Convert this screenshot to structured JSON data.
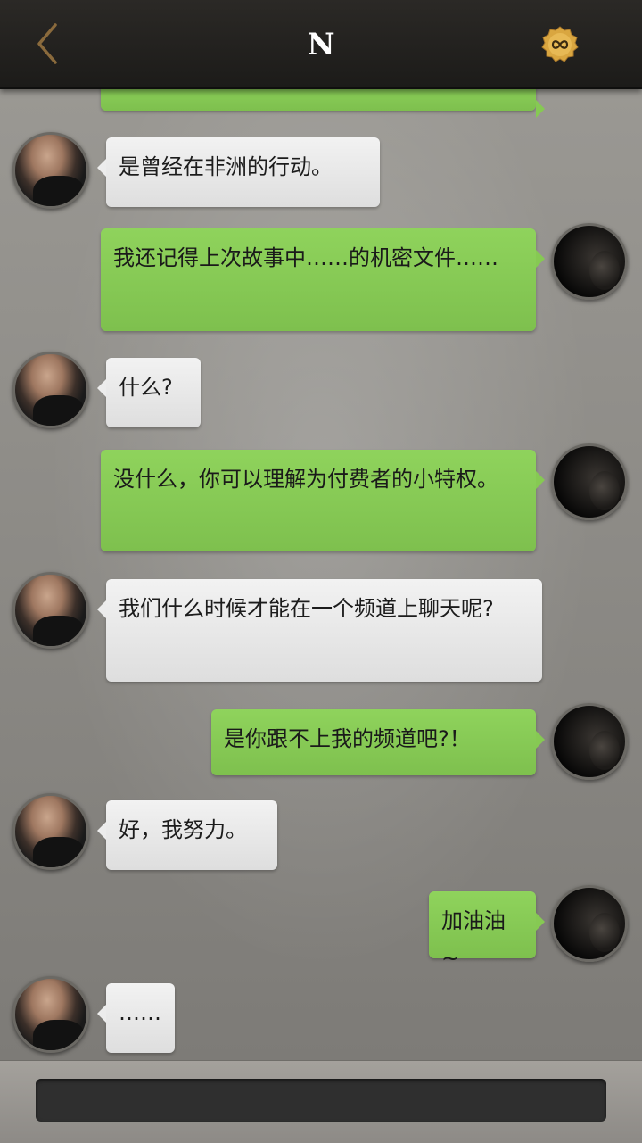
{
  "header": {
    "title": "N",
    "back_icon": "chevron-left-icon",
    "badge_icon": "infinity-badge-icon",
    "colors": {
      "bar": "#1f1e1c",
      "back_chevron": "#8a6a3c",
      "badge": "#d9a640"
    }
  },
  "messages": [
    {
      "side": "right",
      "text": ""
    },
    {
      "side": "left",
      "text": "是曾经在非洲的行动。"
    },
    {
      "side": "right",
      "text": "我还记得上次故事中……的机密文件……"
    },
    {
      "side": "left",
      "text": "什么?"
    },
    {
      "side": "right",
      "text": "没什么，你可以理解为付费者的小特权。"
    },
    {
      "side": "left",
      "text": "我们什么时候才能在一个频道上聊天呢?"
    },
    {
      "side": "right",
      "text": "是你跟不上我的频道吧?！"
    },
    {
      "side": "left",
      "text": "好，我努力。"
    },
    {
      "side": "right",
      "text": "加油油~"
    },
    {
      "side": "left",
      "text": "……"
    }
  ],
  "colors": {
    "incoming_bubble": "#e9e9e9",
    "outgoing_bubble": "#86c953",
    "background": "#8e8c88"
  }
}
